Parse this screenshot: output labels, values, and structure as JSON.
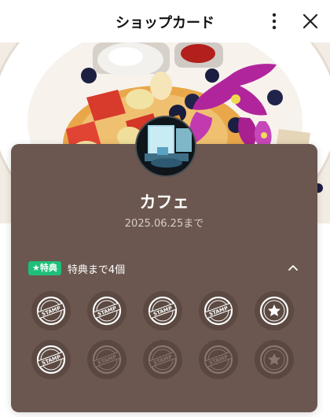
{
  "header": {
    "title": "ショップカード",
    "more_icon": "more-vertical-icon",
    "close_icon": "close-icon"
  },
  "shop": {
    "name": "カフェ",
    "expiry": "2025.06.25まで"
  },
  "perk": {
    "badge": "★特典",
    "text": "特典まで4個"
  },
  "colors": {
    "card": "#6b574f",
    "badge": "#1fbf7a"
  },
  "stamps": [
    {
      "type": "stamp",
      "active": true
    },
    {
      "type": "stamp",
      "active": true
    },
    {
      "type": "stamp",
      "active": true
    },
    {
      "type": "stamp",
      "active": true
    },
    {
      "type": "star",
      "active": true
    },
    {
      "type": "stamp",
      "active": true
    },
    {
      "type": "stamp",
      "active": false
    },
    {
      "type": "stamp",
      "active": false
    },
    {
      "type": "stamp",
      "active": false
    },
    {
      "type": "star",
      "active": false
    }
  ]
}
